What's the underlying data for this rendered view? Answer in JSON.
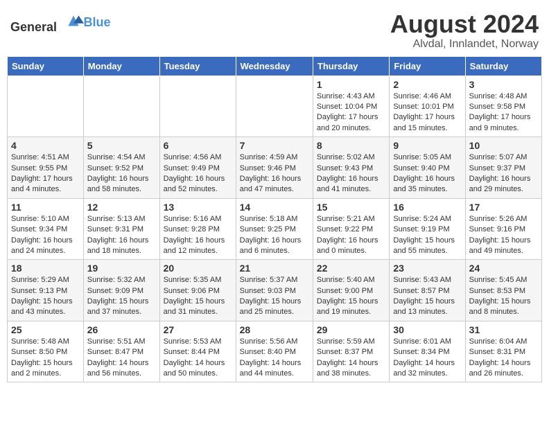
{
  "header": {
    "logo_general": "General",
    "logo_blue": "Blue",
    "title": "August 2024",
    "subtitle": "Alvdal, Innlandet, Norway"
  },
  "weekdays": [
    "Sunday",
    "Monday",
    "Tuesday",
    "Wednesday",
    "Thursday",
    "Friday",
    "Saturday"
  ],
  "weeks": [
    [
      {
        "day": "",
        "info": ""
      },
      {
        "day": "",
        "info": ""
      },
      {
        "day": "",
        "info": ""
      },
      {
        "day": "",
        "info": ""
      },
      {
        "day": "1",
        "info": "Sunrise: 4:43 AM\nSunset: 10:04 PM\nDaylight: 17 hours\nand 20 minutes."
      },
      {
        "day": "2",
        "info": "Sunrise: 4:46 AM\nSunset: 10:01 PM\nDaylight: 17 hours\nand 15 minutes."
      },
      {
        "day": "3",
        "info": "Sunrise: 4:48 AM\nSunset: 9:58 PM\nDaylight: 17 hours\nand 9 minutes."
      }
    ],
    [
      {
        "day": "4",
        "info": "Sunrise: 4:51 AM\nSunset: 9:55 PM\nDaylight: 17 hours\nand 4 minutes."
      },
      {
        "day": "5",
        "info": "Sunrise: 4:54 AM\nSunset: 9:52 PM\nDaylight: 16 hours\nand 58 minutes."
      },
      {
        "day": "6",
        "info": "Sunrise: 4:56 AM\nSunset: 9:49 PM\nDaylight: 16 hours\nand 52 minutes."
      },
      {
        "day": "7",
        "info": "Sunrise: 4:59 AM\nSunset: 9:46 PM\nDaylight: 16 hours\nand 47 minutes."
      },
      {
        "day": "8",
        "info": "Sunrise: 5:02 AM\nSunset: 9:43 PM\nDaylight: 16 hours\nand 41 minutes."
      },
      {
        "day": "9",
        "info": "Sunrise: 5:05 AM\nSunset: 9:40 PM\nDaylight: 16 hours\nand 35 minutes."
      },
      {
        "day": "10",
        "info": "Sunrise: 5:07 AM\nSunset: 9:37 PM\nDaylight: 16 hours\nand 29 minutes."
      }
    ],
    [
      {
        "day": "11",
        "info": "Sunrise: 5:10 AM\nSunset: 9:34 PM\nDaylight: 16 hours\nand 24 minutes."
      },
      {
        "day": "12",
        "info": "Sunrise: 5:13 AM\nSunset: 9:31 PM\nDaylight: 16 hours\nand 18 minutes."
      },
      {
        "day": "13",
        "info": "Sunrise: 5:16 AM\nSunset: 9:28 PM\nDaylight: 16 hours\nand 12 minutes."
      },
      {
        "day": "14",
        "info": "Sunrise: 5:18 AM\nSunset: 9:25 PM\nDaylight: 16 hours\nand 6 minutes."
      },
      {
        "day": "15",
        "info": "Sunrise: 5:21 AM\nSunset: 9:22 PM\nDaylight: 16 hours\nand 0 minutes."
      },
      {
        "day": "16",
        "info": "Sunrise: 5:24 AM\nSunset: 9:19 PM\nDaylight: 15 hours\nand 55 minutes."
      },
      {
        "day": "17",
        "info": "Sunrise: 5:26 AM\nSunset: 9:16 PM\nDaylight: 15 hours\nand 49 minutes."
      }
    ],
    [
      {
        "day": "18",
        "info": "Sunrise: 5:29 AM\nSunset: 9:13 PM\nDaylight: 15 hours\nand 43 minutes."
      },
      {
        "day": "19",
        "info": "Sunrise: 5:32 AM\nSunset: 9:09 PM\nDaylight: 15 hours\nand 37 minutes."
      },
      {
        "day": "20",
        "info": "Sunrise: 5:35 AM\nSunset: 9:06 PM\nDaylight: 15 hours\nand 31 minutes."
      },
      {
        "day": "21",
        "info": "Sunrise: 5:37 AM\nSunset: 9:03 PM\nDaylight: 15 hours\nand 25 minutes."
      },
      {
        "day": "22",
        "info": "Sunrise: 5:40 AM\nSunset: 9:00 PM\nDaylight: 15 hours\nand 19 minutes."
      },
      {
        "day": "23",
        "info": "Sunrise: 5:43 AM\nSunset: 8:57 PM\nDaylight: 15 hours\nand 13 minutes."
      },
      {
        "day": "24",
        "info": "Sunrise: 5:45 AM\nSunset: 8:53 PM\nDaylight: 15 hours\nand 8 minutes."
      }
    ],
    [
      {
        "day": "25",
        "info": "Sunrise: 5:48 AM\nSunset: 8:50 PM\nDaylight: 15 hours\nand 2 minutes."
      },
      {
        "day": "26",
        "info": "Sunrise: 5:51 AM\nSunset: 8:47 PM\nDaylight: 14 hours\nand 56 minutes."
      },
      {
        "day": "27",
        "info": "Sunrise: 5:53 AM\nSunset: 8:44 PM\nDaylight: 14 hours\nand 50 minutes."
      },
      {
        "day": "28",
        "info": "Sunrise: 5:56 AM\nSunset: 8:40 PM\nDaylight: 14 hours\nand 44 minutes."
      },
      {
        "day": "29",
        "info": "Sunrise: 5:59 AM\nSunset: 8:37 PM\nDaylight: 14 hours\nand 38 minutes."
      },
      {
        "day": "30",
        "info": "Sunrise: 6:01 AM\nSunset: 8:34 PM\nDaylight: 14 hours\nand 32 minutes."
      },
      {
        "day": "31",
        "info": "Sunrise: 6:04 AM\nSunset: 8:31 PM\nDaylight: 14 hours\nand 26 minutes."
      }
    ]
  ]
}
